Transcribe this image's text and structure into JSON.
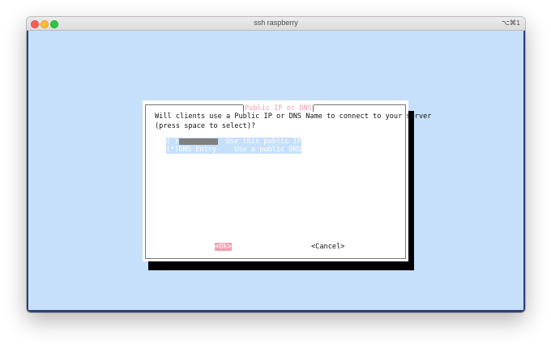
{
  "window": {
    "title": "ssh raspberry",
    "shortcut": "⌥⌘1"
  },
  "dialog": {
    "title": "Public IP or DNS",
    "prompt_line1": "Will clients use a Public IP or DNS Name to connect to your server",
    "prompt_line2": "(press space to select)?",
    "options": [
      {
        "radio": "( )",
        "label": "",
        "label_redacted": true,
        "description": "Use this public IP"
      },
      {
        "radio": "(*)",
        "label": "DNS Entry",
        "label_redacted": false,
        "description": "Use a public DNS"
      }
    ],
    "ok_label": "<Ok>",
    "cancel_label": "<Cancel>"
  },
  "colors": {
    "terminal_bg": "#c6e0fb",
    "dialog_bg": "#ffffff",
    "title_accent": "#f0a0b0",
    "selection": "#c6e0fb"
  }
}
